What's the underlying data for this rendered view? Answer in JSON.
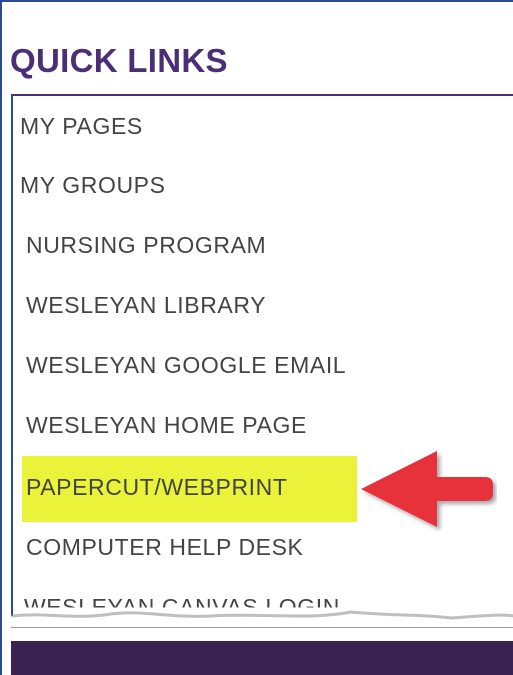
{
  "panel": {
    "title": "QUICK LINKS",
    "links": [
      "MY PAGES",
      "MY GROUPS",
      "NURSING PROGRAM",
      "WESLEYAN LIBRARY",
      "WESLEYAN GOOGLE EMAIL",
      "WESLEYAN HOME PAGE",
      "PAPERCUT/WEBPRINT",
      "COMPUTER HELP DESK",
      "WESLEYAN CANVAS LOGIN"
    ]
  },
  "colors": {
    "title": "#4a2f78",
    "link_text": "#444444",
    "highlight": "#eaf23a",
    "arrow": "#e8323a",
    "footer": "#3a2252"
  },
  "annotation": {
    "highlighted_link": "PAPERCUT/WEBPRINT",
    "arrow_icon": "red-left-arrow-icon"
  }
}
